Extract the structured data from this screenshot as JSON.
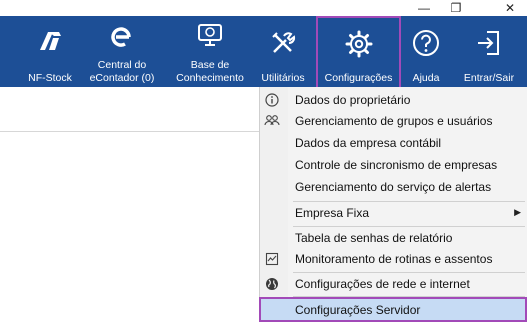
{
  "window": {
    "minimize_glyph": "—",
    "restore_glyph": "❐",
    "close_glyph": "✕"
  },
  "toolbar": {
    "items": [
      {
        "label": "NF-Stock",
        "icon": "nf-stock-logo-icon"
      },
      {
        "label": "Central do\neContador (0)",
        "icon": "econtador-e-icon"
      },
      {
        "label": "Base de\nConhecimento",
        "icon": "monitor-help-icon"
      },
      {
        "label": "Utilitários",
        "icon": "tools-icon"
      },
      {
        "label": "Configurações",
        "icon": "gear-icon"
      },
      {
        "label": "Ajuda",
        "icon": "question-icon"
      },
      {
        "label": "Entrar/Sair",
        "icon": "login-icon"
      }
    ],
    "colors": {
      "background": "#1d4f96",
      "highlight": "#a24ab8"
    }
  },
  "menu": {
    "items": [
      {
        "label": "Dados do proprietário",
        "icon": "info-icon"
      },
      {
        "label": "Gerenciamento de grupos e usuários",
        "icon": "users-icon"
      },
      {
        "label": "Dados da empresa contábil",
        "icon": ""
      },
      {
        "label": "Controle de sincronismo de empresas",
        "icon": ""
      },
      {
        "label": "Gerenciamento do serviço de alertas",
        "icon": ""
      },
      {
        "label": "Empresa Fixa",
        "icon": "",
        "submenu_arrow": "▶"
      },
      {
        "label": "Tabela de senhas de relatório",
        "icon": ""
      },
      {
        "label": "Monitoramento de rotinas e assentos",
        "icon": "monitor-routine-icon"
      },
      {
        "label": "Configurações de rede e internet",
        "icon": "globe-icon"
      },
      {
        "label": "Configurações Servidor",
        "icon": "",
        "selected": true
      }
    ],
    "colors": {
      "selected_bg": "#c6dbf4",
      "selected_border": "#a24ab8"
    }
  }
}
